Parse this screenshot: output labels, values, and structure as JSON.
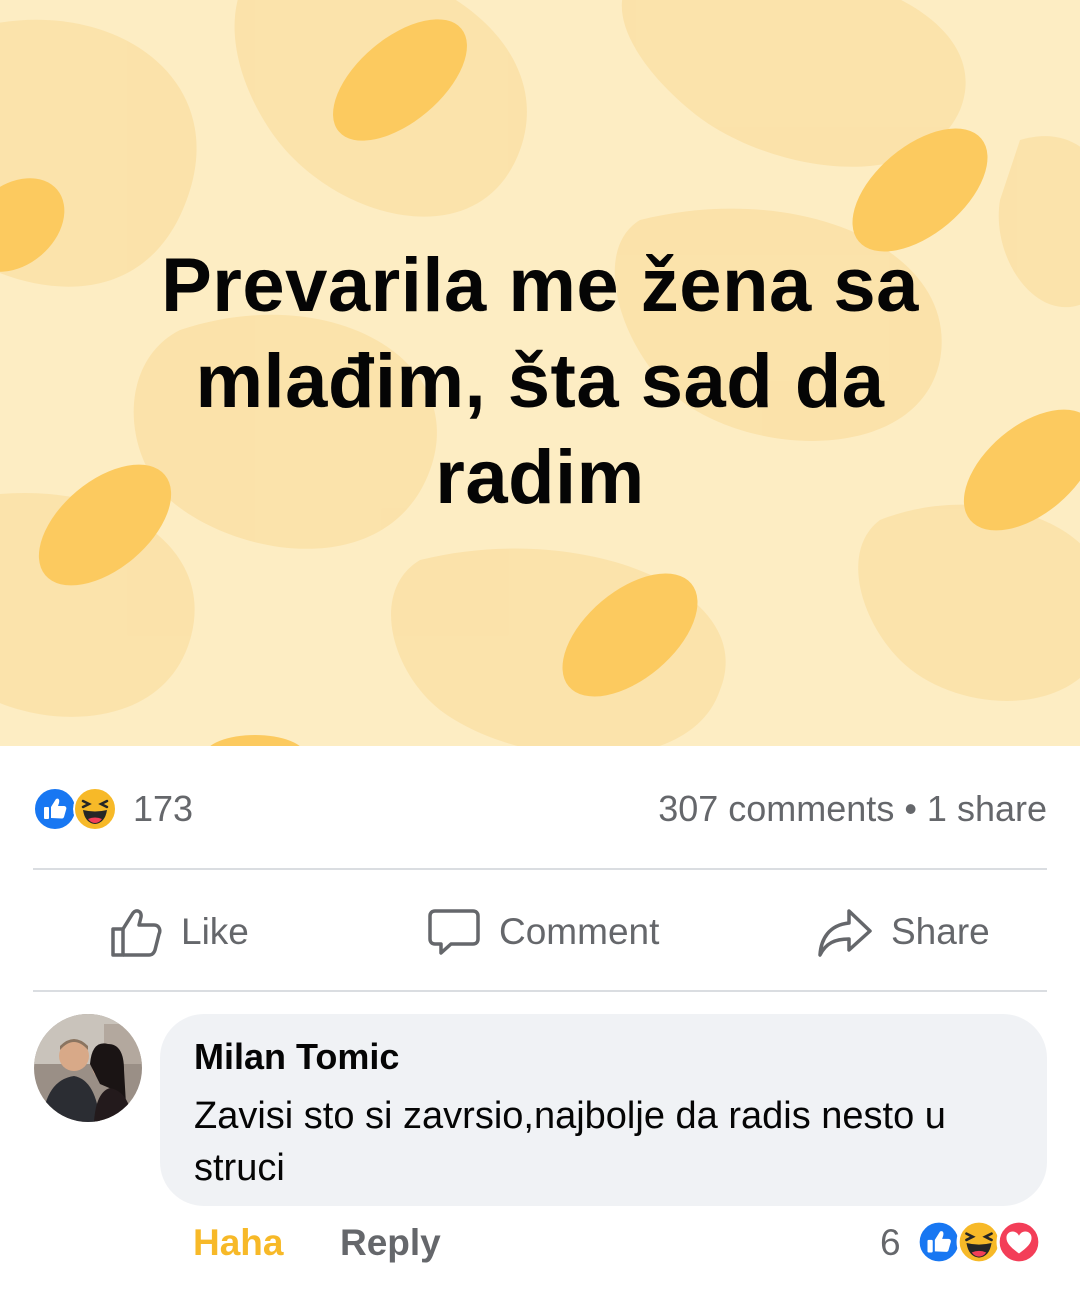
{
  "post": {
    "text": "Prevarila me žena sa mlađim, šta sad da radim",
    "background_color": "#fdedc3",
    "accent_color": "#fcca5f"
  },
  "stats": {
    "reaction_icons": [
      "like-icon",
      "haha-icon"
    ],
    "reaction_count": "173",
    "comments_shares": "307 comments • 1 share"
  },
  "actions": {
    "like_label": "Like",
    "comment_label": "Comment",
    "share_label": "Share"
  },
  "comment": {
    "author": "Milan Tomic",
    "text": "Zavisi sto si zavrsio,najbolje da radis nesto u struci",
    "haha_label": "Haha",
    "reply_label": "Reply",
    "reaction_count": "6",
    "reaction_icons": [
      "like-icon",
      "haha-icon",
      "love-icon"
    ]
  },
  "colors": {
    "secondary_text": "#65676b",
    "haha_yellow": "#f7b928",
    "like_blue": "#1877f2",
    "love_red": "#f33e58"
  }
}
